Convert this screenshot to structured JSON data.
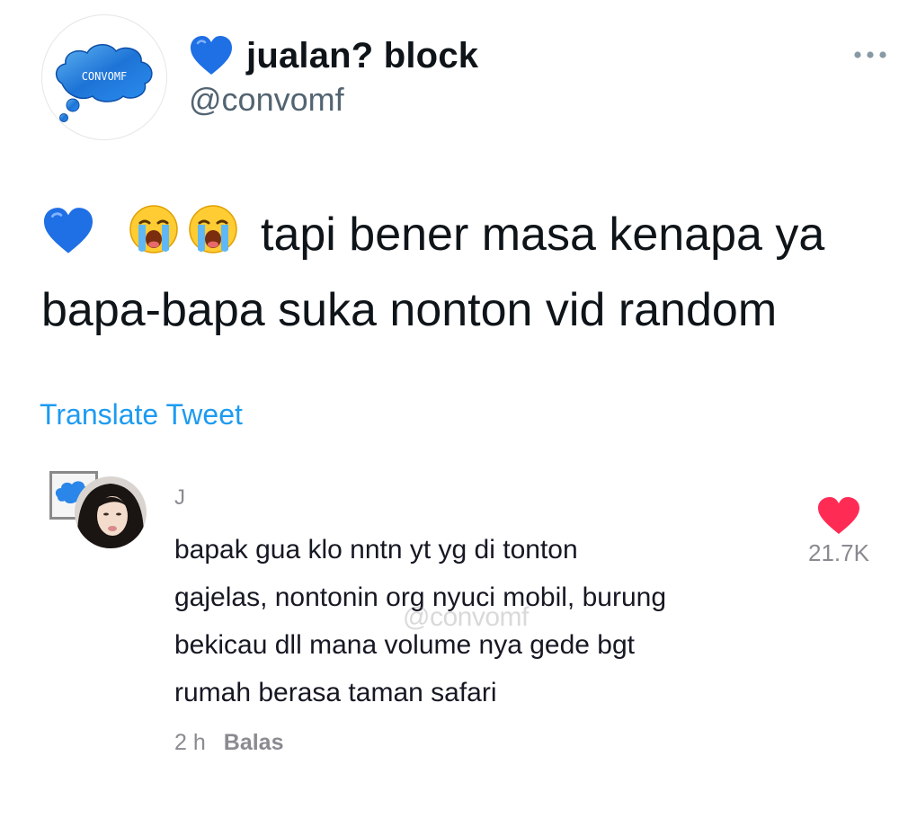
{
  "tweet": {
    "author": {
      "display_name": "jualan? block",
      "handle": "@convomf",
      "avatar_text": "CONVOMF",
      "name_emoji": "blue-heart-icon"
    },
    "text_prefix_emojis": [
      "blue-heart-icon",
      "loudly-crying-face-icon",
      "loudly-crying-face-icon"
    ],
    "text": "tapi bener masa kenapa ya bapa-bapa suka nonton vid random",
    "translate_label": "Translate Tweet",
    "more_icon": "more-dots-icon"
  },
  "comment": {
    "username": "J",
    "lines": [
      "bapak gua klo nntn yt yg di tonton",
      "gajelas, nontonin org nyuci mobil, burung",
      "bekicau dll mana volume nya gede bgt",
      "rumah berasa taman safari"
    ],
    "time": "2 h",
    "reply_label": "Balas",
    "likes": "21.7K",
    "like_icon": "heart-icon",
    "watermark": "@convomf"
  },
  "colors": {
    "accent": "#1d9bf0",
    "like": "#fe2c55",
    "secondary_text": "#536471",
    "comment_meta": "#8a8b91"
  }
}
